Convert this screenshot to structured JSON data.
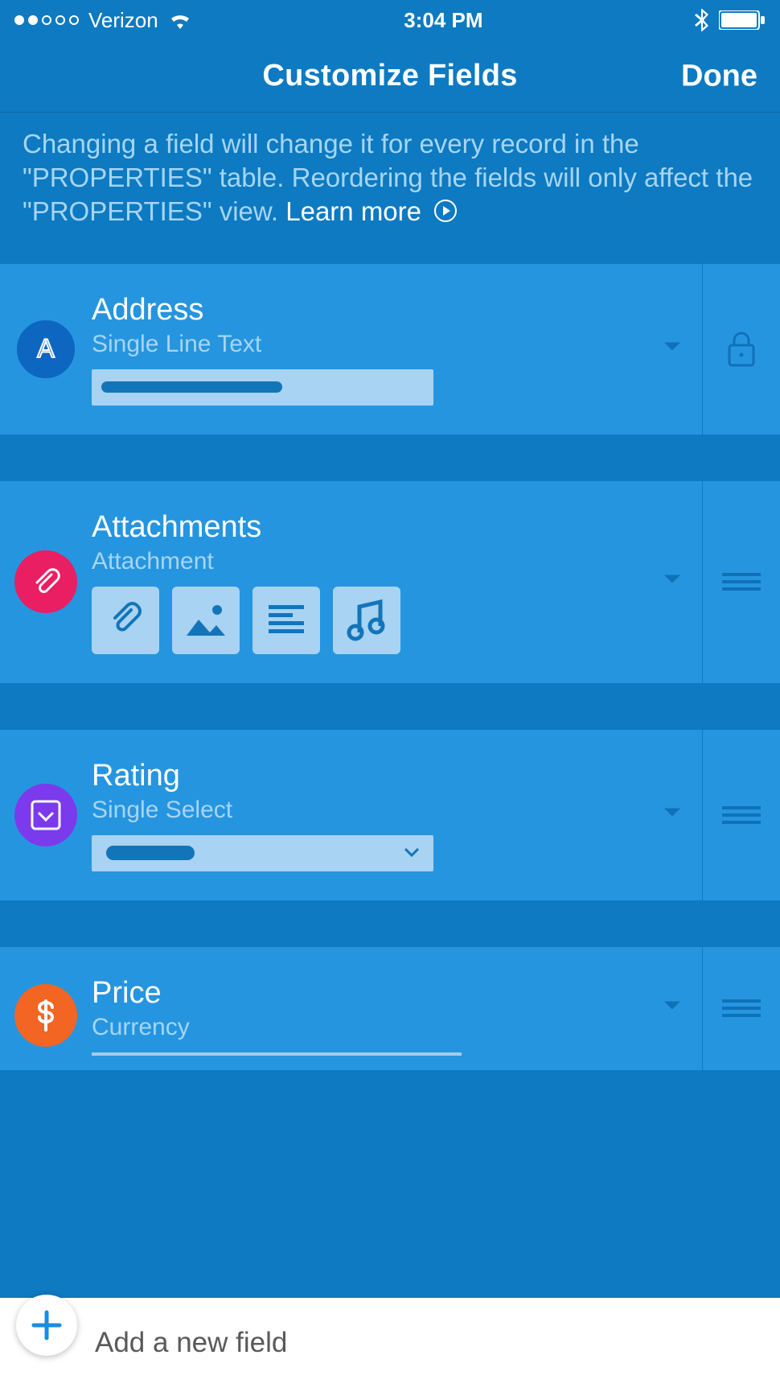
{
  "status": {
    "carrier": "Verizon",
    "time": "3:04 PM"
  },
  "header": {
    "title": "Customize Fields",
    "done": "Done"
  },
  "info": {
    "text": "Changing a field will change it for every record in the \"PROPERTIES\" table. Reordering the fields will only affect the \"PROPERTIES\" view. ",
    "learn_more": "Learn more"
  },
  "fields": [
    {
      "name": "Address",
      "type": "Single Line Text",
      "badge": "text",
      "locked": true
    },
    {
      "name": "Attachments",
      "type": "Attachment",
      "badge": "attach",
      "locked": false
    },
    {
      "name": "Rating",
      "type": "Single Select",
      "badge": "select",
      "locked": false
    },
    {
      "name": "Price",
      "type": "Currency",
      "badge": "currency",
      "locked": false
    }
  ],
  "add": {
    "label": "Add a new field"
  }
}
